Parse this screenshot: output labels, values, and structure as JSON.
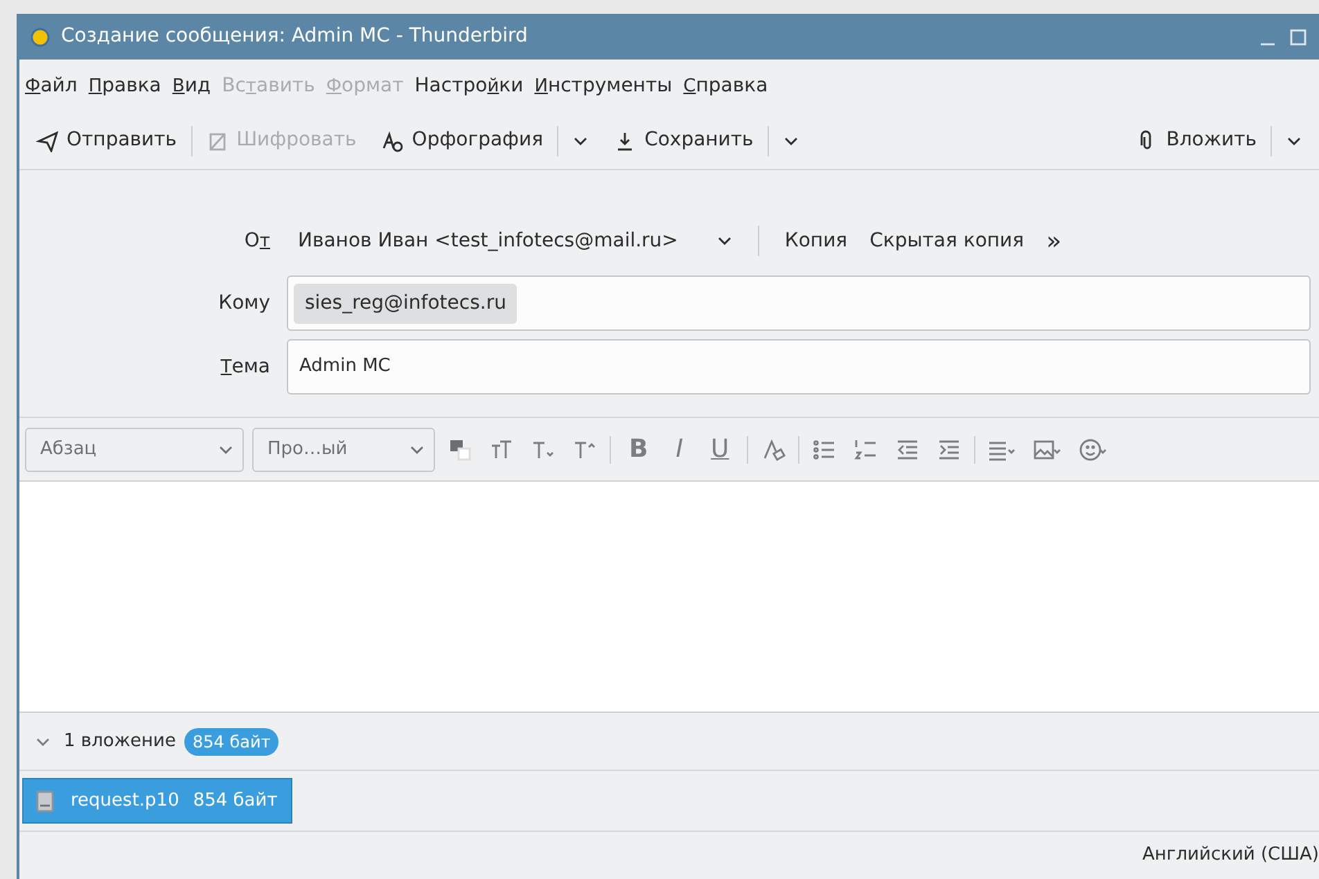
{
  "window": {
    "title": "Создание сообщения: Admin MC - Thunderbird"
  },
  "menu": [
    {
      "access_key": "Ф",
      "after": "айл",
      "disabled": false
    },
    {
      "access_key": "П",
      "after": "равка",
      "disabled": false
    },
    {
      "access_key": "В",
      "after": "ид",
      "disabled": false
    },
    {
      "before": "Вс",
      "access_key": "т",
      "after": "авить",
      "disabled": true
    },
    {
      "access_key": "Ф",
      "after": "ормат",
      "disabled": true
    },
    {
      "before": "Настро",
      "access_key": "й",
      "after": "ки",
      "disabled": false
    },
    {
      "access_key": "И",
      "after": "нструменты",
      "disabled": false
    },
    {
      "access_key": "С",
      "after": "правка",
      "disabled": false
    }
  ],
  "toolbar": [
    {
      "label": "Отправить",
      "disabled": false,
      "dropdown": false
    },
    {
      "label": "Шифровать",
      "disabled": true,
      "dropdown": false
    },
    {
      "label": "Орфография",
      "disabled": false,
      "dropdown": true
    },
    {
      "label": "Сохранить",
      "disabled": false,
      "dropdown": true
    },
    {
      "label": "Вложить",
      "disabled": false,
      "dropdown": true
    }
  ],
  "header": {
    "from_label": "О",
    "from_access_key": "т",
    "from_value": "Иванов Иван <test_infotecs@mail.ru>",
    "cc": "Копия",
    "bcc": "Скрытая копия",
    "more": "»",
    "to_label": "Кому",
    "to_recipients": [
      "sies_reg@infotecs.ru"
    ],
    "subject_access_key": "Т",
    "subject_label": "ема",
    "subject_value": "Admin MC"
  },
  "format_bar": {
    "paragraph": "Абзац",
    "font": "Про…ый",
    "bold": "B",
    "italic": "I",
    "underline": "U"
  },
  "attachments": {
    "expanded": true,
    "summary": "1 вложение",
    "total_size": "854 байт",
    "items": [
      {
        "name": "request.p10",
        "size": "854 байт",
        "selected": true
      }
    ]
  },
  "status_bar": {
    "language": "Английский (США)"
  }
}
